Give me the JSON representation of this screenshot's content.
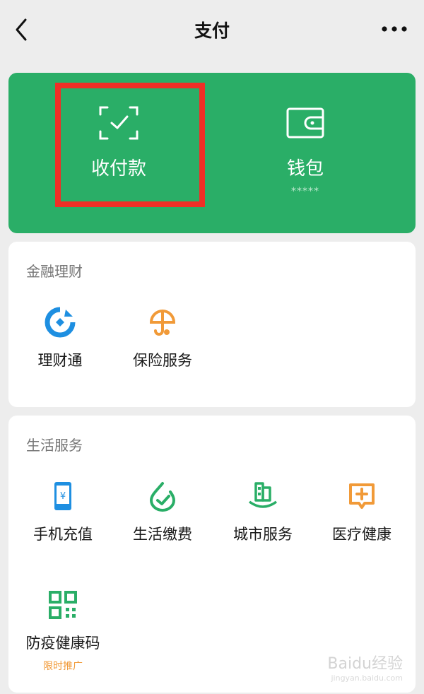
{
  "header": {
    "title": "支付",
    "back_icon": "chevron-left-icon",
    "more_icon": "more-dots-icon"
  },
  "top_card": {
    "color": "#2aae67",
    "highlight_color": "#ef2f26",
    "items": [
      {
        "label": "收付款",
        "icon": "scan-check-icon"
      },
      {
        "label": "钱包",
        "sub": "*****",
        "icon": "wallet-icon"
      }
    ]
  },
  "finance": {
    "title": "金融理财",
    "items": [
      {
        "label": "理财通",
        "icon": "licaitong-icon"
      },
      {
        "label": "保险服务",
        "icon": "insurance-umbrella-icon"
      }
    ]
  },
  "life": {
    "title": "生活服务",
    "items": [
      {
        "label": "手机充值",
        "icon": "phone-yuan-icon"
      },
      {
        "label": "生活缴费",
        "icon": "bill-check-icon"
      },
      {
        "label": "城市服务",
        "icon": "city-buildings-icon"
      },
      {
        "label": "医疗健康",
        "icon": "medical-plus-icon"
      },
      {
        "label": "防疫健康码",
        "tag": "限时推广",
        "icon": "qr-code-icon"
      }
    ]
  },
  "watermark": {
    "text": "Baidu经验",
    "sub": "jingyan.baidu.com"
  }
}
